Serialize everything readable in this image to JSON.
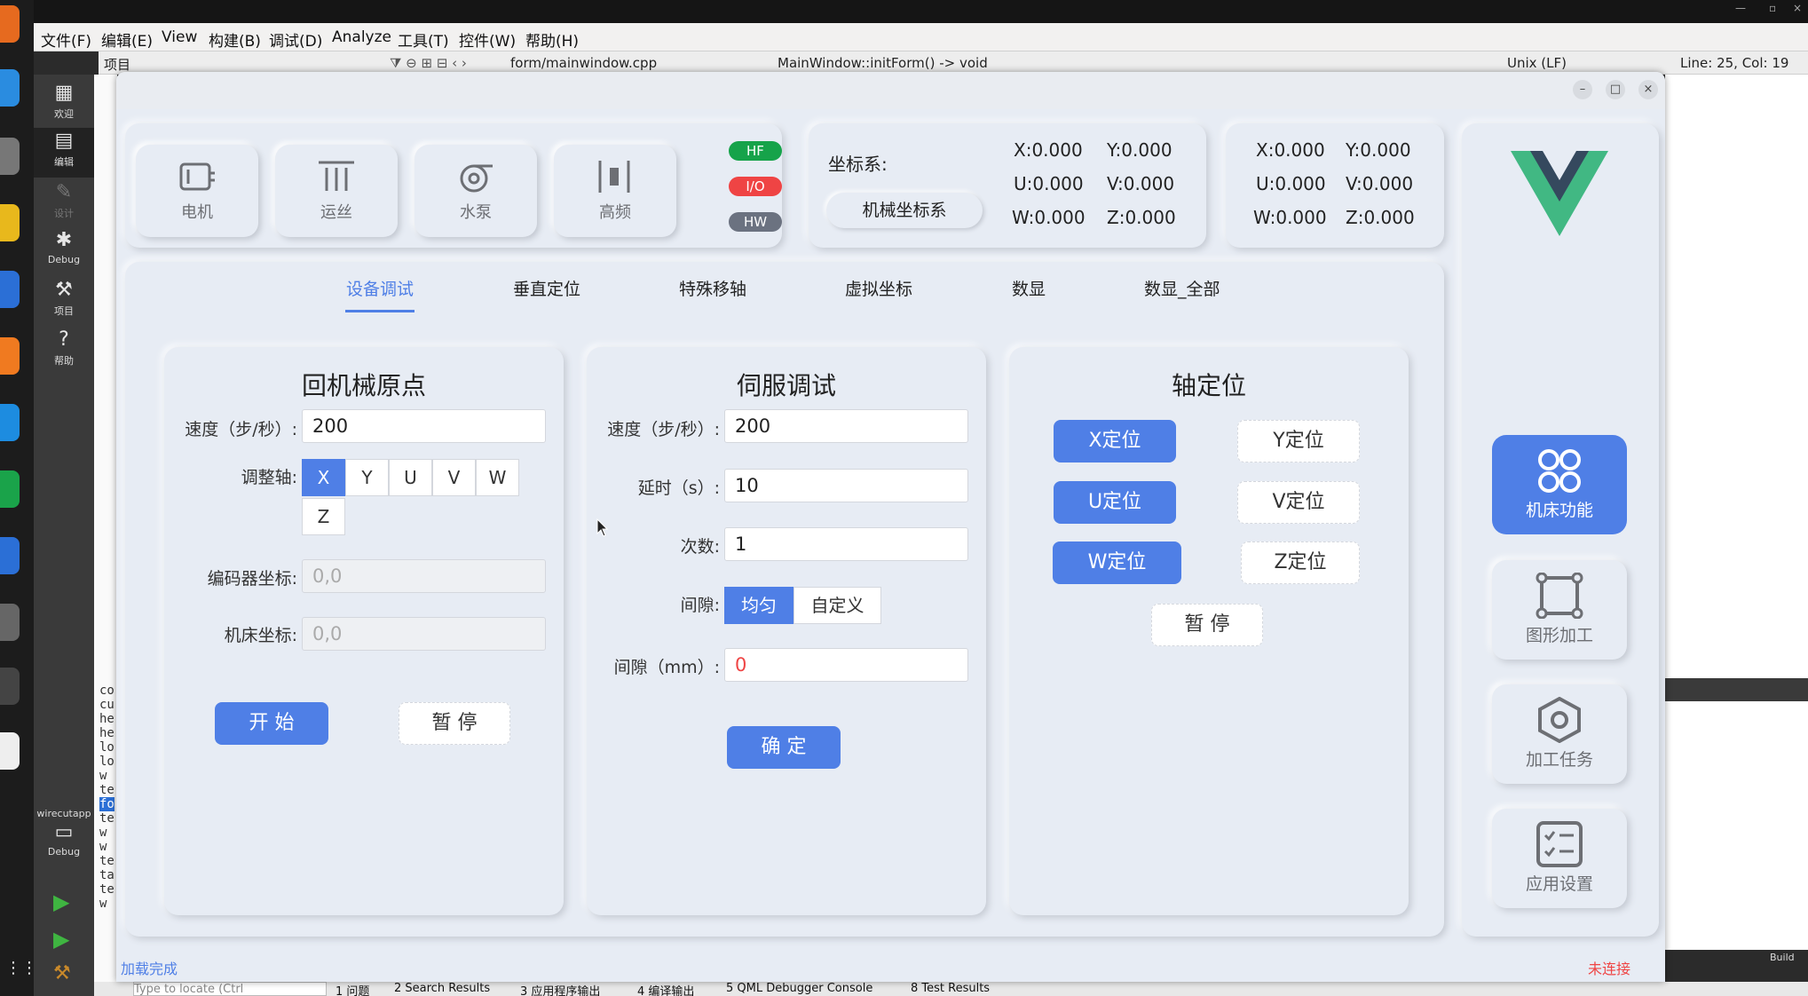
{
  "qt": {
    "menu": [
      "文件(F)",
      "编辑(E)",
      "View",
      "构建(B)",
      "调试(D)",
      "Analyze",
      "工具(T)",
      "控件(W)",
      "帮助(H)"
    ],
    "editor": {
      "project_label": "项目",
      "file": "form/mainwindow.cpp",
      "function": "MainWindow::initForm() -> void",
      "encoding": "Unix (LF)",
      "position": "Line: 25, Col: 19"
    },
    "modes": [
      "欢迎",
      "编辑",
      "设计",
      "Debug",
      "项目",
      "帮助"
    ],
    "target": {
      "name": "wirecutapp",
      "mode": "Debug"
    },
    "bottom_tabs": [
      "1 问题",
      "2 Search Results",
      "3 应用程序输出",
      "4 编译输出",
      "5 QML Debugger Console",
      "8 Test Results"
    ],
    "locator_placeholder": "Type to locate (Ctrl",
    "build_label": "Build",
    "left_strip": [
      "co",
      "cu",
      "he",
      "he",
      "lo",
      "lo",
      "w",
      "te",
      "fo",
      "te",
      "w",
      "w",
      "te",
      "ta",
      "te",
      "w"
    ]
  },
  "app": {
    "tools": [
      "电机",
      "运丝",
      "水泵",
      "高频"
    ],
    "badges": [
      {
        "label": "HF",
        "color": "#16a34a"
      },
      {
        "label": "I/O",
        "color": "#ef4444"
      },
      {
        "label": "HW",
        "color": "#6b7280"
      }
    ],
    "coord_label": "坐标系:",
    "coord_button": "机械坐标系",
    "coords1": [
      "X:0.000",
      "Y:0.000",
      "U:0.000",
      "V:0.000",
      "W:0.000",
      "Z:0.000"
    ],
    "coords2": [
      "X:0.000",
      "Y:0.000",
      "U:0.000",
      "V:0.000",
      "W:0.000",
      "Z:0.000"
    ],
    "tabs": [
      "设备调试",
      "垂直定位",
      "特殊移轴",
      "虚拟坐标",
      "数显",
      "数显_全部"
    ],
    "home": {
      "title": "回机械原点",
      "speed_label": "速度（步/秒）:",
      "speed": "200",
      "axis_label": "调整轴:",
      "axes": [
        "X",
        "Y",
        "U",
        "V",
        "W",
        "Z"
      ],
      "encoder_label": "编码器坐标:",
      "encoder": "0,0",
      "machine_label": "机床坐标:",
      "machine": "0,0",
      "start": "开 始",
      "pause": "暂 停"
    },
    "servo": {
      "title": "伺服调试",
      "speed_label": "速度（步/秒）:",
      "speed": "200",
      "delay_label": "延时（s）:",
      "delay": "10",
      "count_label": "次数:",
      "count": "1",
      "gap_label": "间隙:",
      "gap_modes": [
        "均匀",
        "自定义"
      ],
      "gapmm_label": "间隙（mm）:",
      "gapmm": "0",
      "confirm": "确 定"
    },
    "axis": {
      "title": "轴定位",
      "buttons": [
        "X定位",
        "Y定位",
        "U定位",
        "V定位",
        "W定位",
        "Z定位"
      ],
      "pause": "暂 停"
    },
    "side": [
      "机床功能",
      "图形加工",
      "加工任务",
      "应用设置"
    ],
    "status_left": "加载完成",
    "status_right": "未连接",
    "brand_color": "#4f7fe6"
  }
}
